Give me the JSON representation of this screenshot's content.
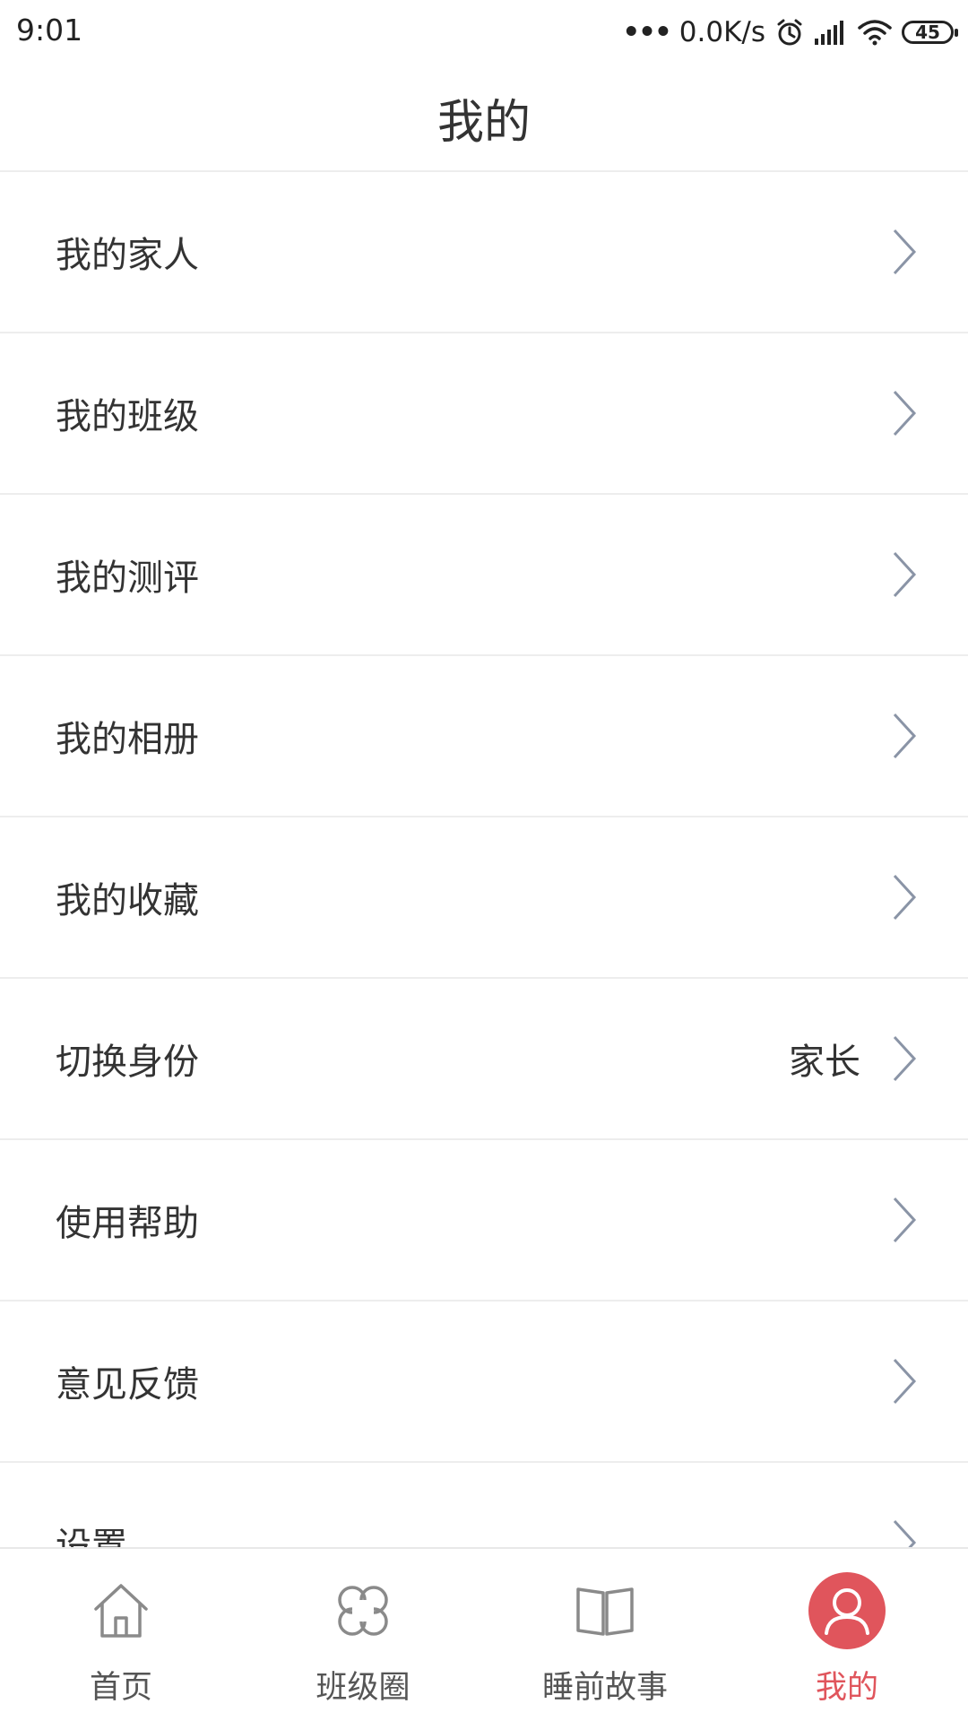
{
  "status_bar": {
    "time": "9:01",
    "dots": "•••",
    "network_speed": "0.0K/s",
    "battery": "45",
    "icons": [
      "alarm-icon",
      "signal-icon",
      "wifi-icon",
      "battery-icon"
    ]
  },
  "header": {
    "title": "我的"
  },
  "menu": {
    "items": [
      {
        "label": "我的家人",
        "value": ""
      },
      {
        "label": "我的班级",
        "value": ""
      },
      {
        "label": "我的测评",
        "value": ""
      },
      {
        "label": "我的相册",
        "value": ""
      },
      {
        "label": "我的收藏",
        "value": ""
      },
      {
        "label": "切换身份",
        "value": "家长"
      },
      {
        "label": "使用帮助",
        "value": ""
      },
      {
        "label": "意见反馈",
        "value": ""
      },
      {
        "label": "设置",
        "value": ""
      }
    ]
  },
  "bottom_nav": {
    "items": [
      {
        "label": "首页",
        "icon": "home-icon",
        "active": false
      },
      {
        "label": "班级圈",
        "icon": "clover-icon",
        "active": false
      },
      {
        "label": "睡前故事",
        "icon": "book-icon",
        "active": false
      },
      {
        "label": "我的",
        "icon": "user-icon",
        "active": true
      }
    ]
  },
  "colors": {
    "accent": "#e0555c",
    "chevron": "#8a94a6",
    "divider": "#ededed",
    "text": "#333333"
  }
}
